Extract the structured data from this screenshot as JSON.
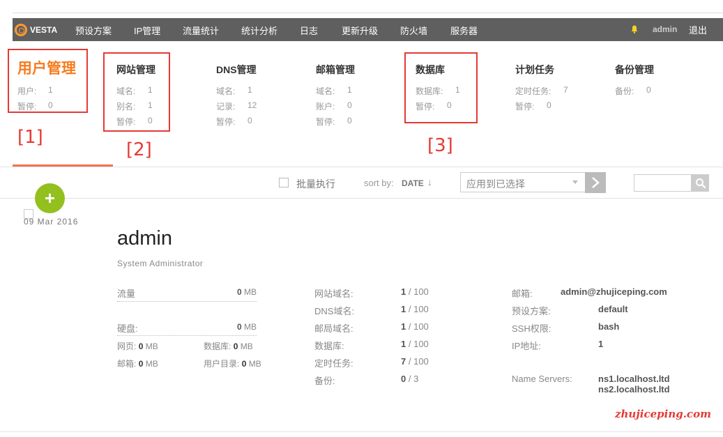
{
  "nav": {
    "logo": "VESTA",
    "items": [
      "预设方案",
      "IP管理",
      "流量统计",
      "统计分析",
      "日志",
      "更新升级",
      "防火墙",
      "服务器"
    ],
    "user": "admin",
    "logout": "退出"
  },
  "categories": [
    {
      "title": "用户管理",
      "stats": [
        {
          "label": "用户:",
          "value": "1"
        },
        {
          "label": "暂停:",
          "value": "0"
        }
      ]
    },
    {
      "title": "网站管理",
      "stats": [
        {
          "label": "域名:",
          "value": "1"
        },
        {
          "label": "别名:",
          "value": "1"
        },
        {
          "label": "暂停:",
          "value": "0"
        }
      ]
    },
    {
      "title": "DNS管理",
      "stats": [
        {
          "label": "域名:",
          "value": "1"
        },
        {
          "label": "记录:",
          "value": "12"
        },
        {
          "label": "暂停:",
          "value": "0"
        }
      ]
    },
    {
      "title": "邮箱管理",
      "stats": [
        {
          "label": "域名:",
          "value": "1"
        },
        {
          "label": "账户:",
          "value": "0"
        },
        {
          "label": "暂停:",
          "value": "0"
        }
      ]
    },
    {
      "title": "数据库",
      "stats": [
        {
          "label": "数据库:",
          "value": "1"
        },
        {
          "label": "暂停:",
          "value": "0"
        }
      ]
    },
    {
      "title": "计划任务",
      "stats": [
        {
          "label": "定时任务:",
          "value": "7"
        },
        {
          "label": "暂停:",
          "value": "0"
        }
      ]
    },
    {
      "title": "备份管理",
      "stats": [
        {
          "label": "备份:",
          "value": "0"
        }
      ]
    }
  ],
  "annotations": [
    "[1]",
    "[2]",
    "[3]"
  ],
  "toolbar": {
    "bulk_label": "批量执行",
    "sort_label": "sort by:",
    "sort_value": "DATE",
    "sort_arrow": "↓",
    "apply_placeholder": "应用到已选择",
    "search_value": ""
  },
  "add_icon": "+",
  "user": {
    "date": "09  Mar  2016",
    "name": "admin",
    "role": "System Administrator",
    "bandwidth_label": "流量",
    "bandwidth_value": "0",
    "bandwidth_unit": "MB",
    "disk_label": "硬盘:",
    "disk_value": "0",
    "disk_unit": "MB",
    "disk_breakdown": [
      {
        "label": "网页:",
        "value": "0",
        "unit": "MB"
      },
      {
        "label": "数据库:",
        "value": "0",
        "unit": "MB"
      },
      {
        "label": "邮箱:",
        "value": "0",
        "unit": "MB"
      },
      {
        "label": "用户目录:",
        "value": "0",
        "unit": "MB"
      }
    ],
    "limits": [
      {
        "label": "网站域名:",
        "used": "1",
        "total": "/ 100"
      },
      {
        "label": "DNS域名:",
        "used": "1",
        "total": "/ 100"
      },
      {
        "label": "邮局域名:",
        "used": "1",
        "total": "/ 100"
      },
      {
        "label": "数据库:",
        "used": "1",
        "total": "/ 100"
      },
      {
        "label": "定时任务:",
        "used": "7",
        "total": "/ 100"
      },
      {
        "label": "备份:",
        "used": "0",
        "total": "/ 3"
      }
    ],
    "info": [
      {
        "label": "邮箱:",
        "value": "admin@zhujiceping.com"
      },
      {
        "label": "预设方案:",
        "value": "default"
      },
      {
        "label": "SSH权限:",
        "value": "bash"
      },
      {
        "label": "IP地址:",
        "value": "1"
      }
    ],
    "ns_label": "Name Servers:",
    "ns": [
      "ns1.localhost.ltd",
      "ns2.localhost.ltd"
    ]
  },
  "watermark": "zhujiceping.com",
  "colors": {
    "accent": "#f57c1f",
    "annotation": "#e53935",
    "add_button": "#93c01f",
    "navbar": "#5f5f5f"
  }
}
